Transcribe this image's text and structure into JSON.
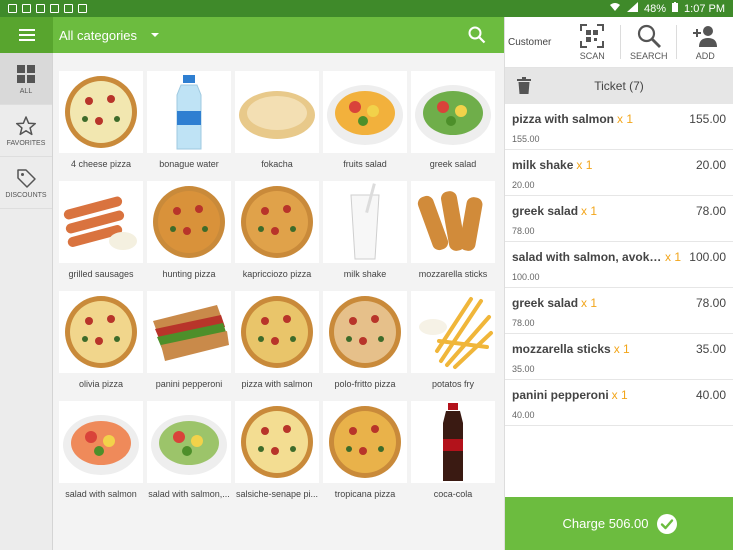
{
  "statusbar": {
    "battery": "48%",
    "time": "1:07 PM"
  },
  "topbar": {
    "category": "All categories"
  },
  "sidebar": {
    "items": [
      {
        "label": "ALL"
      },
      {
        "label": "FAVORITES"
      },
      {
        "label": "DISCOUNTS"
      }
    ]
  },
  "products": [
    {
      "name": "4 cheese pizza",
      "kind": "pizza",
      "color": "#f2e7b0"
    },
    {
      "name": "bonague water",
      "kind": "bottle",
      "color": "#bfe3f5"
    },
    {
      "name": "fokacha",
      "kind": "bread",
      "color": "#e8c98a"
    },
    {
      "name": "fruits salad",
      "kind": "bowl",
      "color": "#f2b13c"
    },
    {
      "name": "greek salad",
      "kind": "bowl",
      "color": "#6fae4a"
    },
    {
      "name": "grilled sausages",
      "kind": "sausage",
      "color": "#d9733f"
    },
    {
      "name": "hunting pizza",
      "kind": "pizza",
      "color": "#d9923a"
    },
    {
      "name": "kapricciozo pizza",
      "kind": "pizza",
      "color": "#e0a24a"
    },
    {
      "name": "milk shake",
      "kind": "glass",
      "color": "#f5f5f5"
    },
    {
      "name": "mozzarella sticks",
      "kind": "sticks",
      "color": "#d18b3a"
    },
    {
      "name": "olivia pizza",
      "kind": "pizza",
      "color": "#f1d68c"
    },
    {
      "name": "panini pepperoni",
      "kind": "sandwich",
      "color": "#c98a4a"
    },
    {
      "name": "pizza with salmon",
      "kind": "pizza",
      "color": "#e9c56a"
    },
    {
      "name": "polo-fritto pizza",
      "kind": "pizza",
      "color": "#e6c08a"
    },
    {
      "name": "potatos fry",
      "kind": "fries",
      "color": "#f0b63a"
    },
    {
      "name": "salad with salmon",
      "kind": "bowl",
      "color": "#ef8a5a"
    },
    {
      "name": "salad with salmon,...",
      "kind": "bowl",
      "color": "#9cc46a"
    },
    {
      "name": "salsiche-senape pi...",
      "kind": "pizza",
      "color": "#f3dd92"
    },
    {
      "name": "tropicana pizza",
      "kind": "pizza",
      "color": "#e9b24a"
    },
    {
      "name": "coca-cola",
      "kind": "cola",
      "color": "#b3121b"
    }
  ],
  "panel": {
    "customer": "Customer",
    "tools": [
      {
        "label": "SCAN"
      },
      {
        "label": "SEARCH"
      },
      {
        "label": "ADD"
      }
    ],
    "ticket_title": "Ticket (7)",
    "lines": [
      {
        "name": "pizza with salmon",
        "qty": "x 1",
        "price": "155.00",
        "total": "155.00"
      },
      {
        "name": "milk shake",
        "qty": "x 1",
        "price": "20.00",
        "total": "20.00"
      },
      {
        "name": "greek salad",
        "qty": "x 1",
        "price": "78.00",
        "total": "78.00"
      },
      {
        "name": "salad with salmon, avokado...",
        "qty": "x 1",
        "price": "100.00",
        "total": "100.00"
      },
      {
        "name": "greek salad",
        "qty": "x 1",
        "price": "78.00",
        "total": "78.00"
      },
      {
        "name": "mozzarella sticks",
        "qty": "x 1",
        "price": "35.00",
        "total": "35.00"
      },
      {
        "name": "panini pepperoni",
        "qty": "x 1",
        "price": "40.00",
        "total": "40.00"
      }
    ],
    "charge_label": "Charge 506.00"
  },
  "colors": {
    "brand_green": "#6cbc3f",
    "dark_green": "#3f8a2a",
    "qty_orange": "#f2a51a"
  }
}
